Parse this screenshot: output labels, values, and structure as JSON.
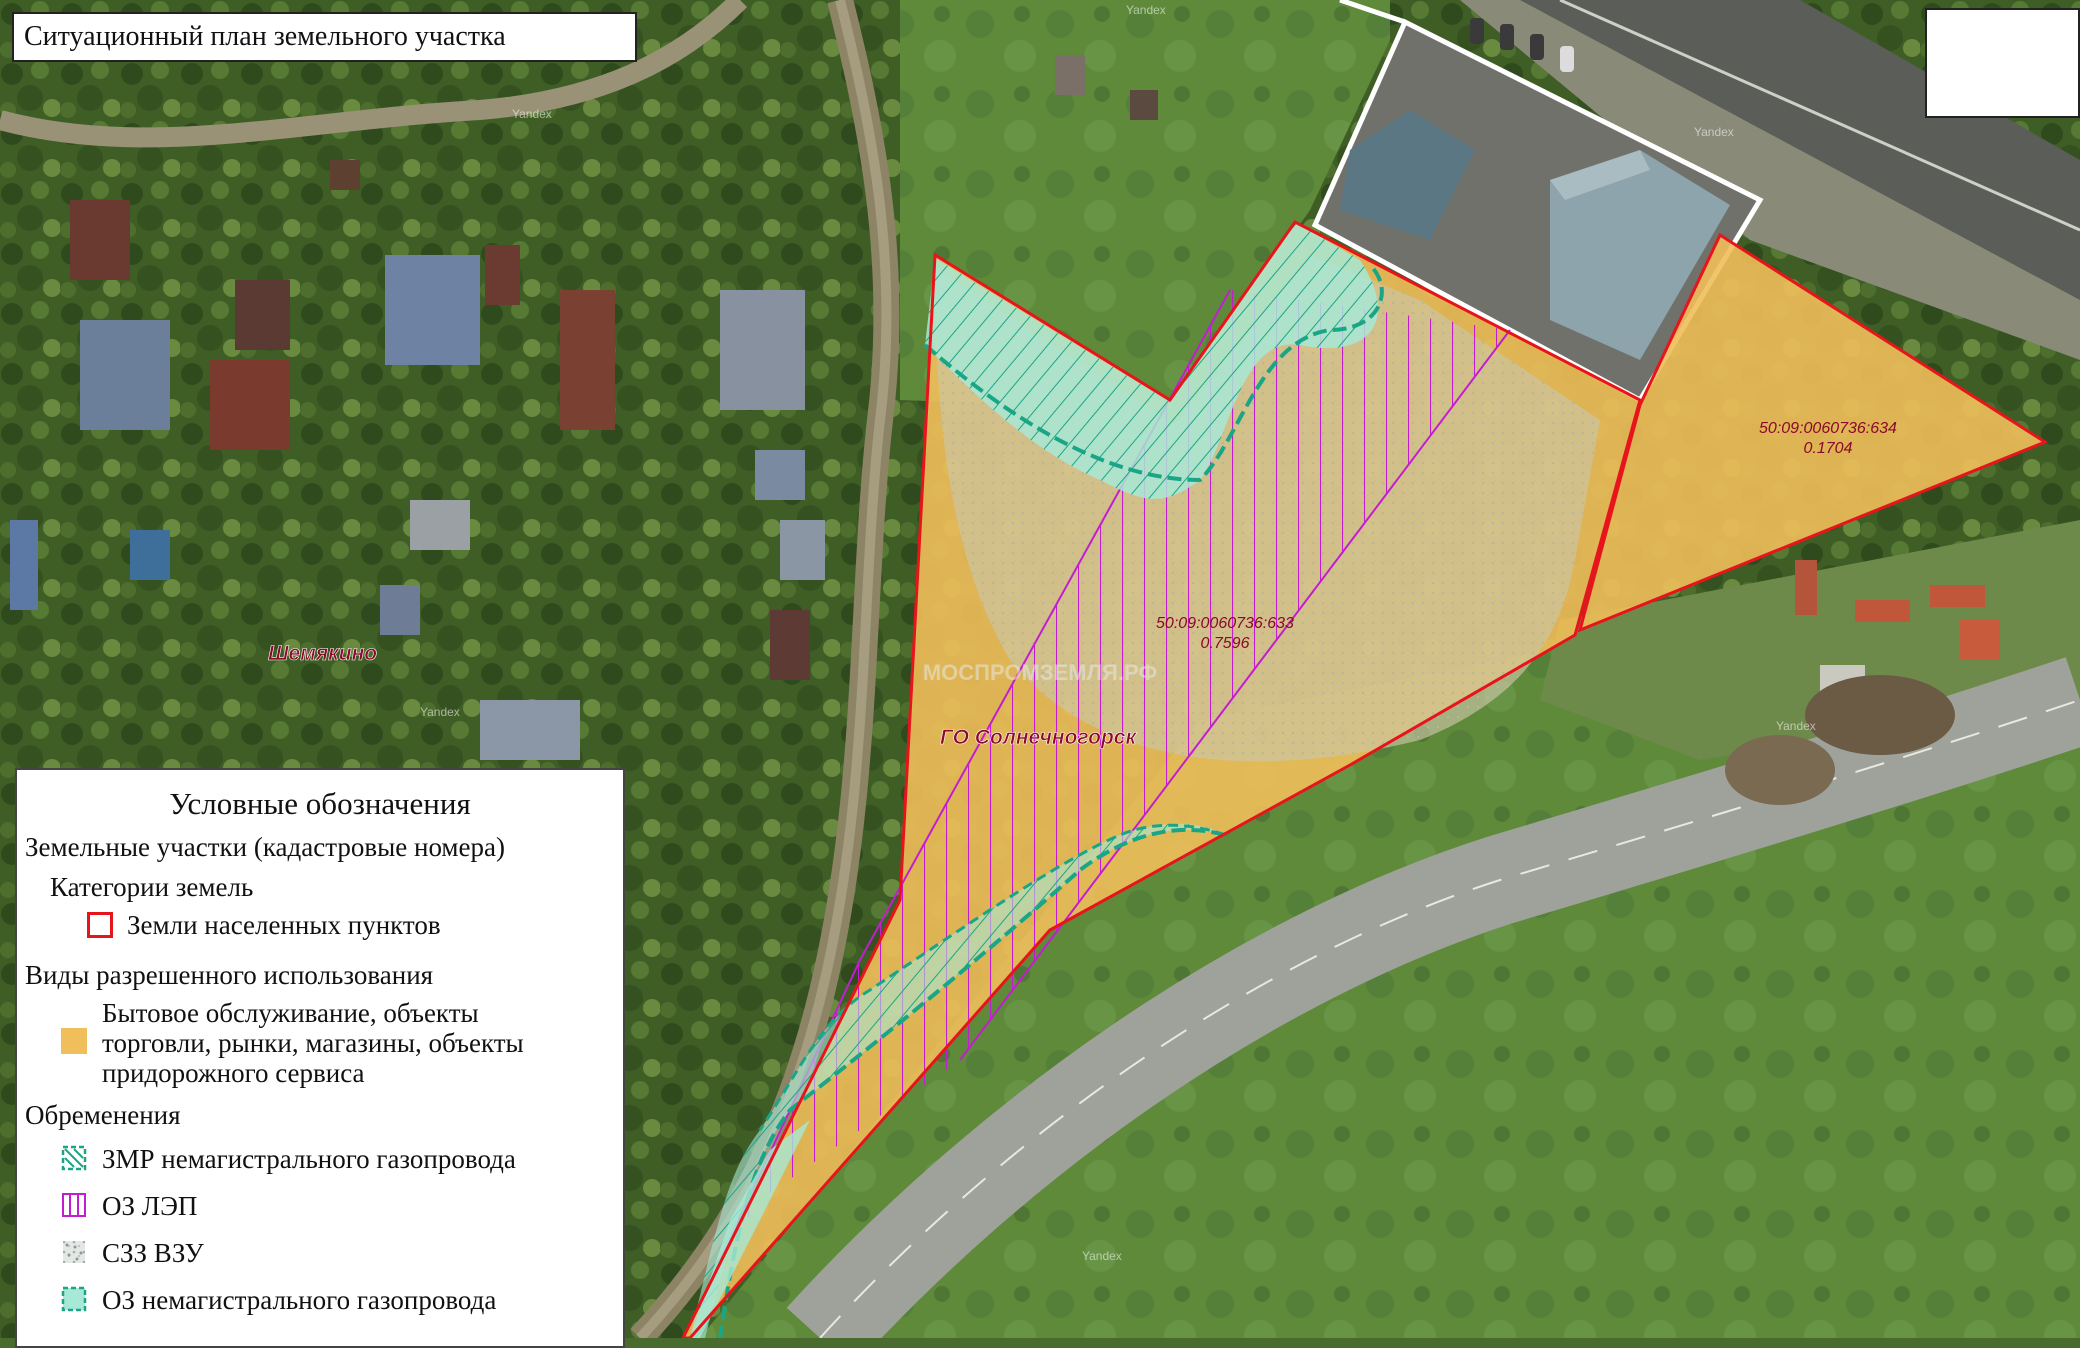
{
  "title": "Ситуационный план земельного участка",
  "map": {
    "place_label": "Шемякино",
    "district_label": "ГО Солнечногорск",
    "watermark": "МОСПРОМЗЕМЛЯ.РФ",
    "yandex_mark": "Yandex",
    "parcels": [
      {
        "cadastral": "50:09:0060736:633",
        "area": "0.7596"
      },
      {
        "cadastral": "50:09:0060736:634",
        "area": "0.1704"
      }
    ]
  },
  "legend": {
    "title": "Условные обозначения",
    "section_parcels": "Земельные участки (кадастровые номера)",
    "subsection_categories": "Категории земель",
    "category_settlements": "Земли населенных пунктов",
    "section_uses": "Виды разрешенного использования",
    "use_line1": "Бытовое обслуживание, объекты",
    "use_line2": "торговли, рынки, магазины, объекты",
    "use_line3": "придорожного сервиса",
    "section_encumbrances": "Обременения",
    "enc_gas_zmr": "ЗМР немагистрального газопровода",
    "enc_power": "ОЗ ЛЭП",
    "enc_water": "СЗЗ ВЗУ",
    "enc_gas_oz": "ОЗ немагистрального газопровода"
  },
  "colors": {
    "boundary": "#e8141c",
    "parcel_fill": "#f0be5a",
    "power_hatch": "#c21ed0",
    "gas_zone": "#1aa686",
    "gas_fill": "#a8e8d6",
    "label": "#8b0a2a"
  }
}
